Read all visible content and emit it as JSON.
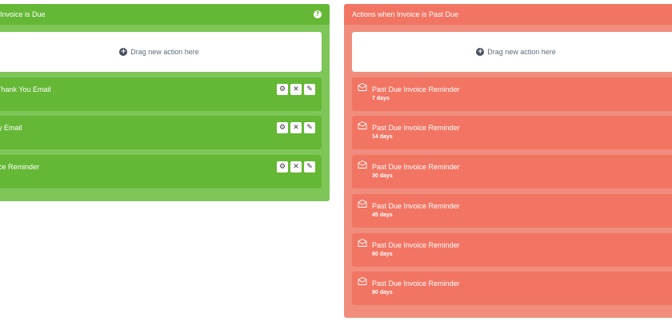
{
  "due_panel": {
    "title": "Invoice is Due",
    "help_icon": "?",
    "drop_label": "Drag new action here",
    "actions": [
      {
        "label": "Thank You Email"
      },
      {
        "label": "ly Email"
      },
      {
        "label": "ice Reminder"
      }
    ],
    "action_buttons": {
      "settings": "⚙",
      "delete": "✕",
      "edit": "✎"
    }
  },
  "past_due_panel": {
    "title": "Actions when Invoice is Past Due",
    "drop_label": "Drag new action here",
    "actions": [
      {
        "label": "Past Due Invoice Reminder",
        "days": "7 days"
      },
      {
        "label": "Past Due Invoice Reminder",
        "days": "14 days"
      },
      {
        "label": "Past Due Invoice Reminder",
        "days": "30 days"
      },
      {
        "label": "Past Due Invoice Reminder",
        "days": "45 days"
      },
      {
        "label": "Past Due Invoice Reminder",
        "days": "60 days"
      },
      {
        "label": "Past Due Invoice Reminder",
        "days": "90 days"
      }
    ]
  },
  "icons": {
    "plus": "+",
    "mail": "mail-icon"
  },
  "colors": {
    "green_panel": "#7dc657",
    "green_header": "#65b836",
    "red_panel": "#f08d7d",
    "red_header": "#f27563"
  }
}
